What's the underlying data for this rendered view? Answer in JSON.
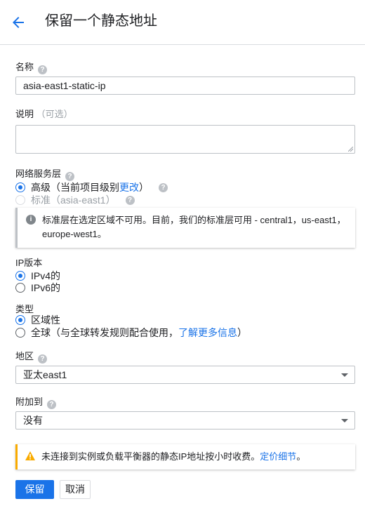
{
  "header": {
    "title": "保留一个静态地址",
    "back_icon": "arrow-left-icon"
  },
  "name_field": {
    "label": "名称",
    "value": "asia-east1-static-ip"
  },
  "description_field": {
    "label": "说明",
    "optional": "（可选）",
    "value": ""
  },
  "network_tier": {
    "label": "网络服务层",
    "premium": {
      "label": "高级（当前项目级别",
      "link": "更改",
      "suffix": "）",
      "selected": true
    },
    "standard": {
      "label": "标准（asia-east1）",
      "selected": false,
      "disabled": true
    },
    "info": "标准层在选定区域不可用。目前，我们的标准层可用 - central1，us-east1，europe-west1。"
  },
  "ip_version": {
    "label": "IP版本",
    "options": [
      {
        "label": "IPv4的",
        "selected": true
      },
      {
        "label": "IPv6的",
        "selected": false
      }
    ]
  },
  "type": {
    "label": "类型",
    "regional": {
      "label": "区域性",
      "selected": true
    },
    "global": {
      "label": "全球（与全球转发规则配合使用，",
      "link": "了解更多信息",
      "suffix": "）",
      "selected": false
    }
  },
  "region": {
    "label": "地区",
    "value": "亚太east1"
  },
  "attach_to": {
    "label": "附加到",
    "value": "没有"
  },
  "warning": {
    "text": "未连接到实例或负载平衡器的静态IP地址按小时收费。",
    "link": "定价细节",
    "suffix": "。"
  },
  "actions": {
    "save": "保留",
    "cancel": "取消"
  },
  "colors": {
    "accent": "#1a73e8",
    "warning": "#f9ab00"
  }
}
